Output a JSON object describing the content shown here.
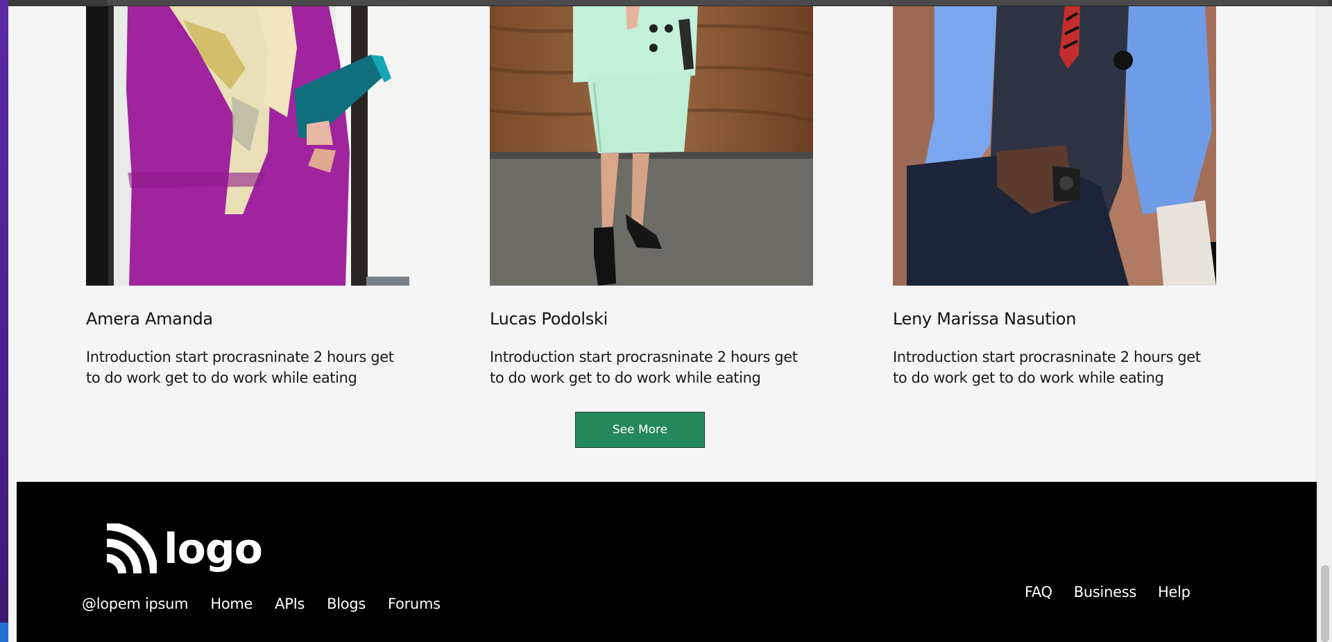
{
  "cards": [
    {
      "name": "Amera Amanda",
      "description": "Introduction start procrasninate 2 hours get to do work get to do work while eating",
      "photo_icon": "person-purple-dress-scarf-folder"
    },
    {
      "name": "Lucas Podolski",
      "description": "Introduction start procrasninate 2 hours get to do work get to do work while eating",
      "photo_icon": "person-mint-suit-heels"
    },
    {
      "name": "Leny Marissa Nasution",
      "description": "Introduction start procrasninate 2 hours get to do work get to do work while eating",
      "photo_icon": "person-blue-shirt-vest-seated"
    }
  ],
  "see_more_label": "See More",
  "footer": {
    "logo_text": "logo",
    "logo_icon": "signal-arcs-logo",
    "left_links": [
      "@lopem ipsum",
      "Home",
      "APIs",
      "Blogs",
      "Forums"
    ],
    "right_links": [
      "FAQ",
      "Business",
      "Help"
    ]
  },
  "colors": {
    "button_bg": "#25875c",
    "footer_bg": "#000000",
    "page_bg": "#f5f5f5",
    "desktop_accent": "#5a2aa8"
  }
}
